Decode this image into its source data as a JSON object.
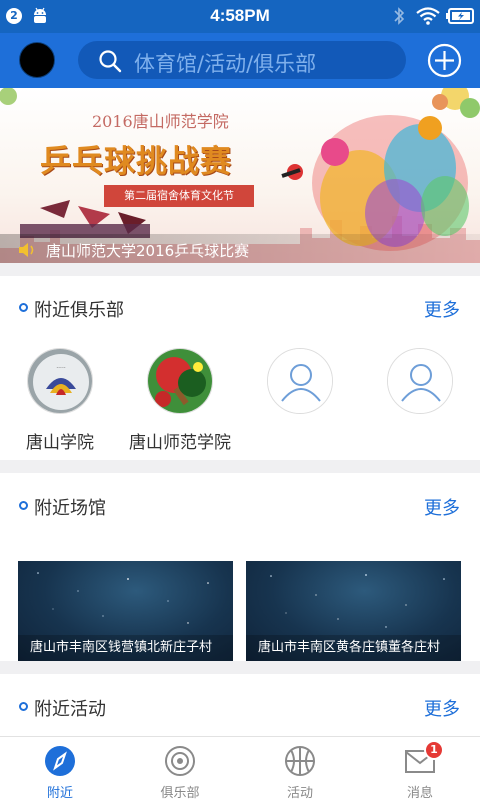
{
  "status_bar": {
    "notification_count": "2",
    "time": "4:58PM",
    "icons": [
      "android-icon",
      "bluetooth-icon",
      "wifi-icon",
      "battery-charging-icon"
    ]
  },
  "header": {
    "search_placeholder": "体育馆/活动/俱乐部",
    "icons": [
      "avatar",
      "search-icon",
      "add-circle-icon"
    ]
  },
  "banner": {
    "university": "2016唐山师范学院",
    "title": "乒乓球挑战赛",
    "ribbon": "第二届宿舍体育文化节",
    "caption": "唐山师范大学2016乒乓球比赛"
  },
  "nearby_clubs": {
    "title": "附近俱乐部",
    "more": "更多",
    "items": [
      {
        "name": "唐山学院",
        "icon": "club-logo-image"
      },
      {
        "name": "唐山师范学院",
        "icon": "ping-pong-image"
      },
      {
        "name": "",
        "icon": "user-placeholder-icon"
      },
      {
        "name": "",
        "icon": "user-placeholder-icon"
      }
    ]
  },
  "nearby_venues": {
    "title": "附近场馆",
    "more": "更多",
    "items": [
      {
        "name": "唐山市丰南区钱营镇北新庄子村"
      },
      {
        "name": "唐山市丰南区黄各庄镇董各庄村"
      }
    ]
  },
  "nearby_activities": {
    "title": "附近活动",
    "more": "更多"
  },
  "tab_bar": {
    "tabs": [
      {
        "label": "附近",
        "icon": "compass-icon",
        "active": true
      },
      {
        "label": "俱乐部",
        "icon": "target-icon",
        "active": false
      },
      {
        "label": "活动",
        "icon": "basketball-icon",
        "active": false
      },
      {
        "label": "消息",
        "icon": "mail-icon",
        "active": false,
        "badge": "1"
      }
    ]
  },
  "colors": {
    "primary": "#1e6fd9",
    "status_bar": "#1565c0",
    "badge": "#e53935"
  }
}
